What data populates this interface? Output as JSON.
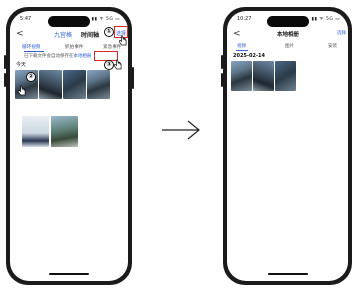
{
  "left_screen": {
    "time": "5:47",
    "status_icons": "▮▮ ᯤ 5G ▭",
    "header": {
      "back": "<",
      "tab1": "九宫格",
      "tab2": "时间轴",
      "action": "选择"
    },
    "filter_tabs": [
      "循环视频",
      "抓拍事件",
      "紧急事件"
    ],
    "notice": {
      "prefix": "已下载文件会自动保存在",
      "link": "本地相册"
    },
    "section_title": "今天",
    "step_labels": [
      "①",
      "②",
      "③"
    ]
  },
  "right_screen": {
    "time": "10:27",
    "status_icons": "▮▮ ᯤ 5G ▭",
    "header": {
      "back": "<",
      "title": "本地相册",
      "action": "选择"
    },
    "tabs": [
      "视频",
      "图片",
      "安装"
    ],
    "date": "2025-02-14"
  },
  "arrow": "→",
  "colors": {
    "accent": "#3060d8",
    "annotation_red": "#e02a2a"
  }
}
